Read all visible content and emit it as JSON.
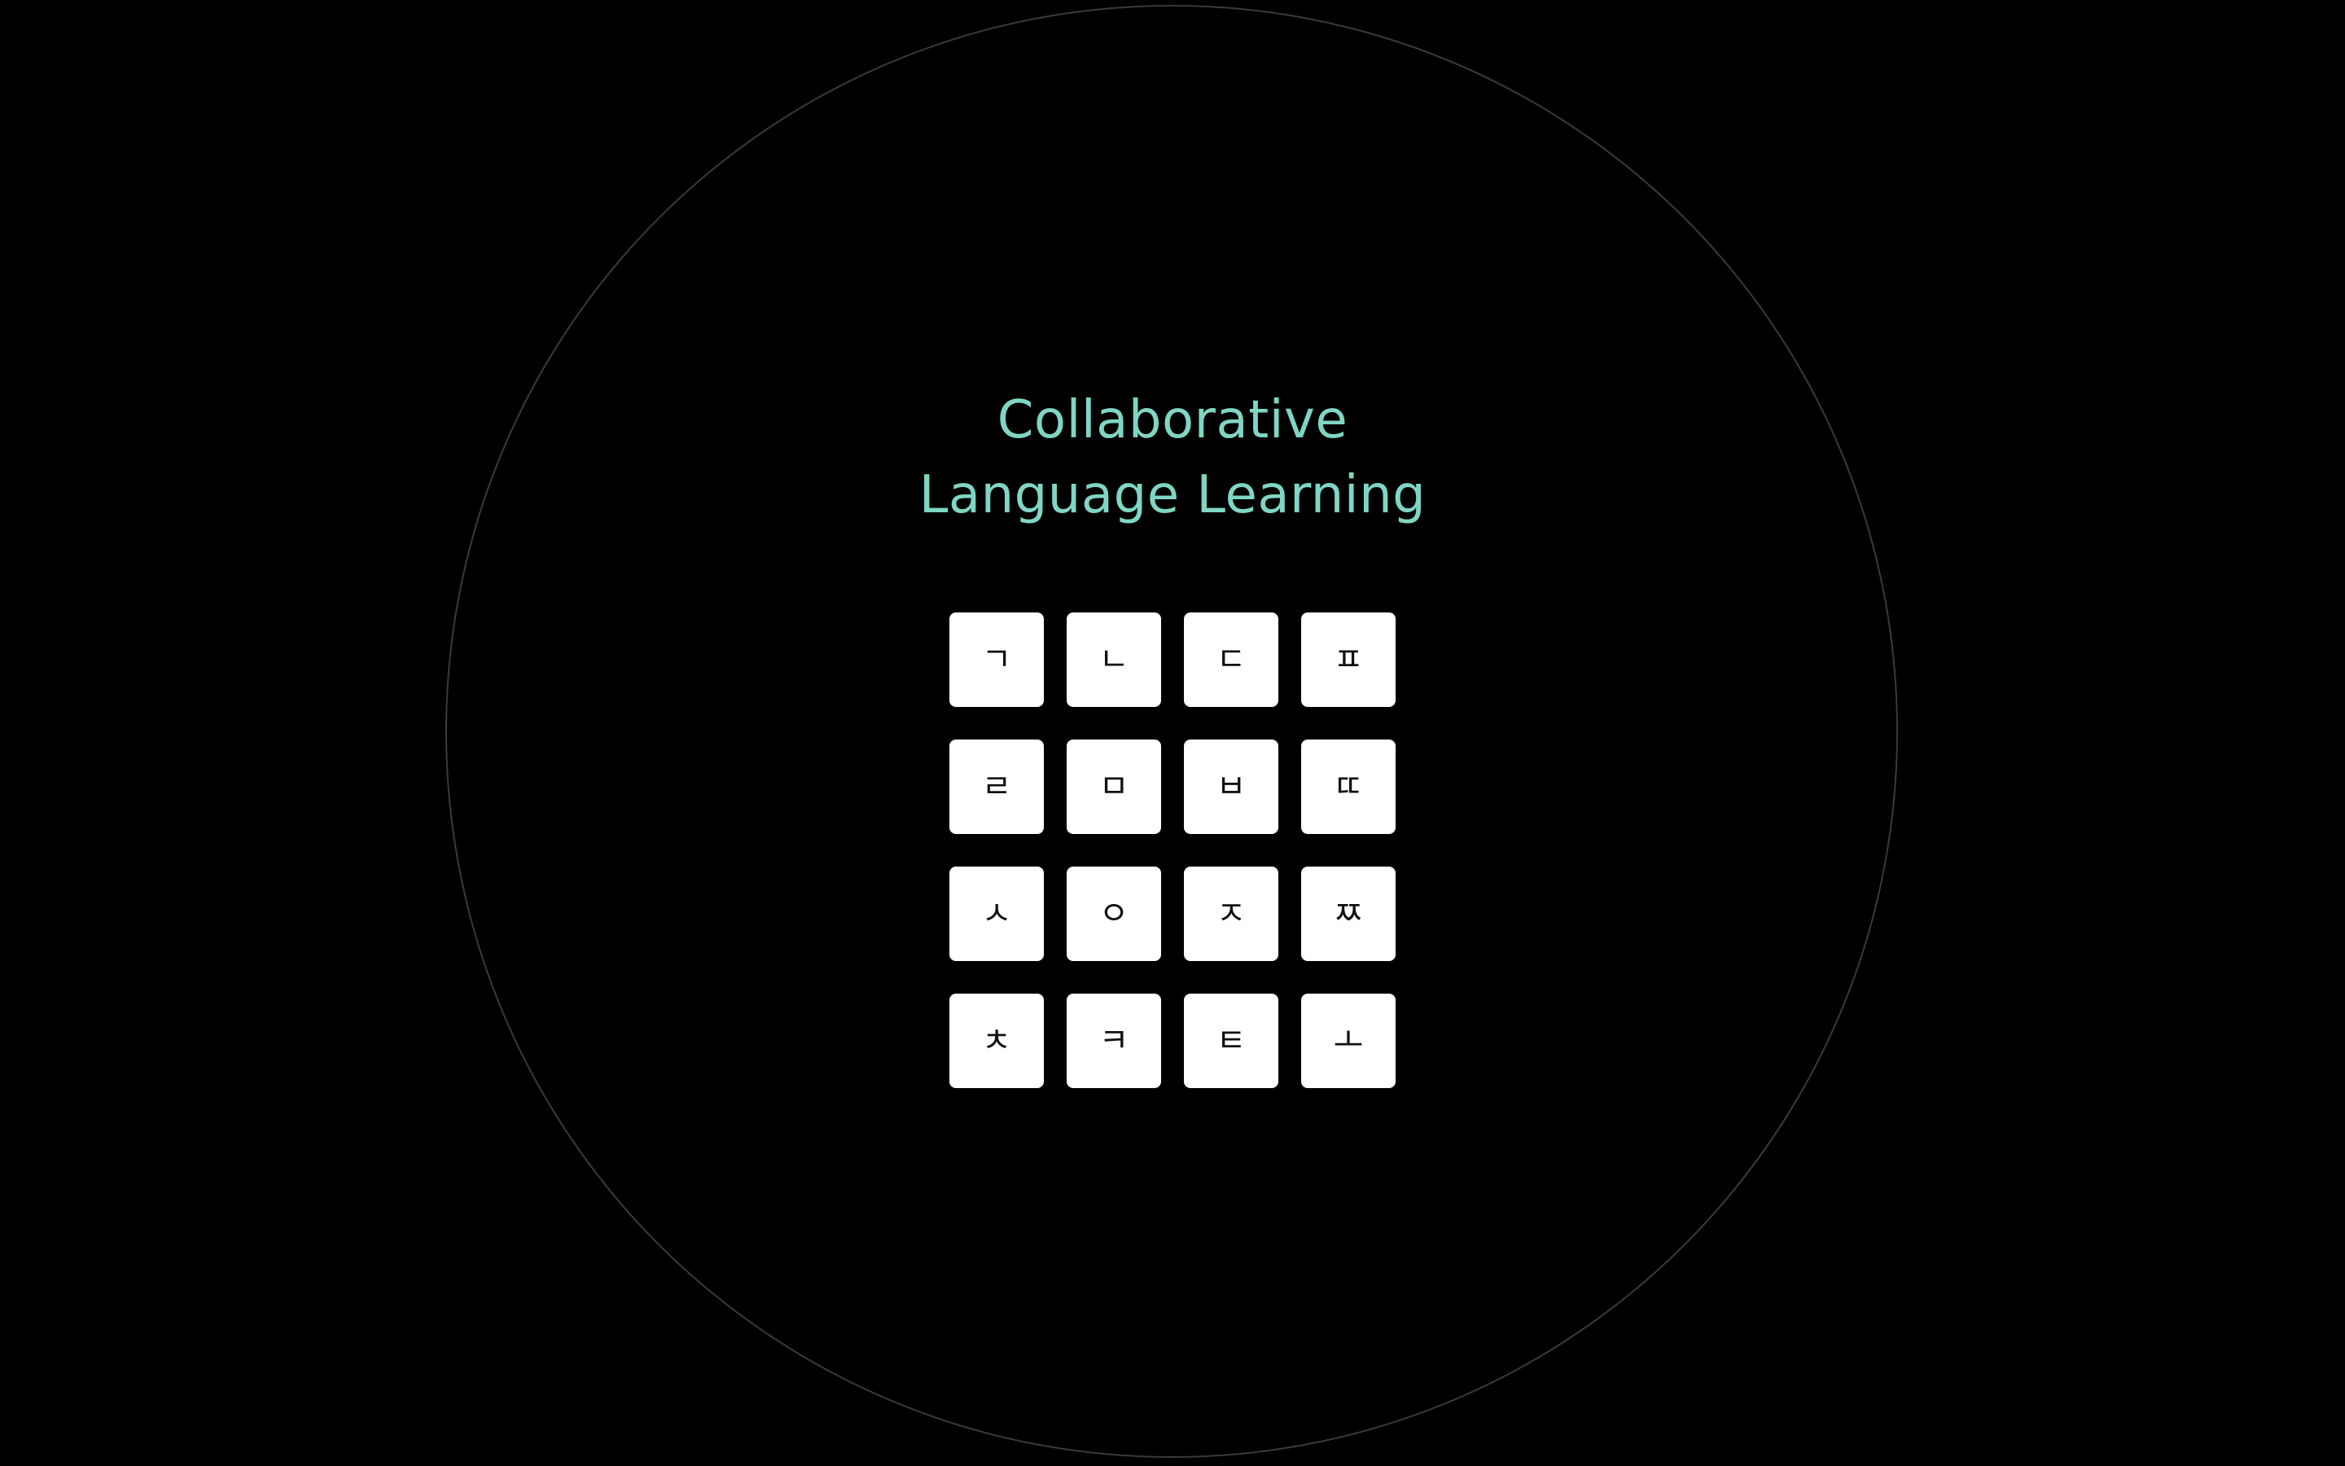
{
  "colors": {
    "background": "#000000",
    "accent": "#7fd6c4",
    "ring": "#3a3a3a",
    "tile": "#ffffff",
    "glyph": "#111111"
  },
  "header": {
    "title_line1": "Collaborative",
    "title_line2": "Language Learning"
  },
  "tiles": [
    {
      "glyph": "ㄱ"
    },
    {
      "glyph": "ㄴ"
    },
    {
      "glyph": "ㄷ"
    },
    {
      "glyph": "ㅍ"
    },
    {
      "glyph": "ㄹ"
    },
    {
      "glyph": "ㅁ"
    },
    {
      "glyph": "ㅂ"
    },
    {
      "glyph": "ㄸ"
    },
    {
      "glyph": "ㅅ"
    },
    {
      "glyph": "ㅇ"
    },
    {
      "glyph": "ㅈ"
    },
    {
      "glyph": "ㅉ"
    },
    {
      "glyph": "ㅊ"
    },
    {
      "glyph": "ㅋ"
    },
    {
      "glyph": "ㅌ"
    },
    {
      "glyph": "ㅗ"
    }
  ]
}
